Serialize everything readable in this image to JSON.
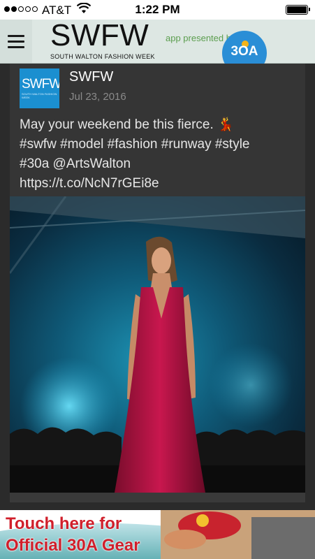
{
  "status_bar": {
    "carrier": "AT&T",
    "time": "1:22 PM",
    "signal_bars": 2,
    "signal_total": 5
  },
  "header": {
    "logo_title": "SWFW",
    "logo_subtitle": "SOUTH WALTON FASHION WEEK",
    "presented_by": "app presented by",
    "badge_text": "3OA"
  },
  "post": {
    "avatar_text": "SWFW",
    "author": "SWFW",
    "date": "Jul 23, 2016",
    "text": "May your weekend be this fierce. 💃\n#swfw #model #fashion #runway #style\n#30a @ArtsWalton\nhttps://t.co/NcN7rGEi8e"
  },
  "ad": {
    "line1": "Touch here for",
    "line2": "Official 30A Gear"
  },
  "colors": {
    "header_bg": "#dde7e3",
    "body_bg": "#2b2b2b",
    "card_bg": "#353535",
    "accent_blue": "#1b8fd0",
    "presented_green": "#5c9e4f",
    "ad_red": "#d01f2b"
  },
  "icons": [
    "hamburger-menu-icon",
    "wifi-icon",
    "battery-icon",
    "signal-dots-icon"
  ]
}
